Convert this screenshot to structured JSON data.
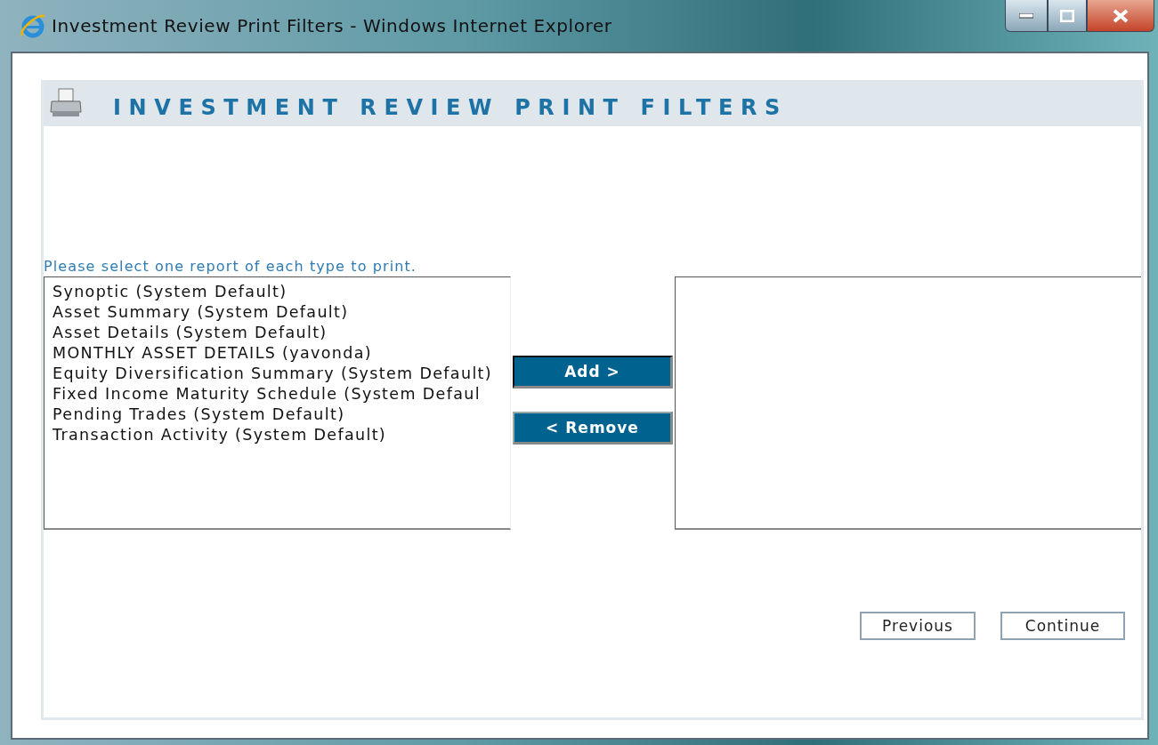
{
  "window": {
    "title": "Investment Review Print Filters - Windows Internet Explorer"
  },
  "header": {
    "title": "INVESTMENT REVIEW PRINT FILTERS"
  },
  "instruction": "Please select one report of each type to print.",
  "available_reports": [
    {
      "label": "Synoptic (System Default)",
      "selected": false
    },
    {
      "label": "Asset Summary (System Default)",
      "selected": false
    },
    {
      "label": "Asset Details (System Default)",
      "selected": false
    },
    {
      "label": "MONTHLY ASSET DETAILS (yavonda)",
      "selected": false
    },
    {
      "label": "Equity Diversification Summary (System Default)",
      "selected": false
    },
    {
      "label": "Fixed Income Maturity Schedule (System Defaul",
      "selected": false
    },
    {
      "label": "Pending Trades (System Default)",
      "selected": false
    },
    {
      "label": "Transaction Activity (System Default)",
      "selected": false
    }
  ],
  "transfer_buttons": [
    {
      "label": "Add >",
      "focused": true
    },
    {
      "label": "< Remove",
      "focused": false
    }
  ],
  "nav_buttons": [
    "Previous",
    "Continue"
  ]
}
